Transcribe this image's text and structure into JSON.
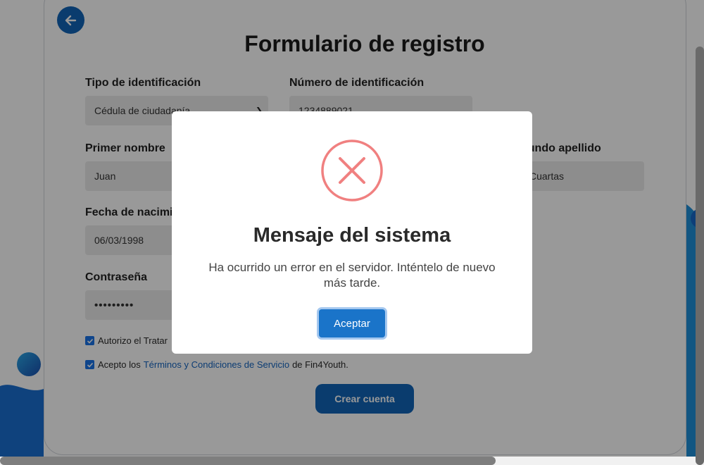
{
  "form": {
    "title": "Formulario de registro",
    "back_icon": "arrow-left-icon",
    "id_type": {
      "label": "Tipo de identificación",
      "value": "Cédula de ciudadanía"
    },
    "id_number": {
      "label": "Número de identificación",
      "value": "1234889021"
    },
    "first_name": {
      "label": "Primer nombre",
      "value": "Juan"
    },
    "second_surname": {
      "label": "Segundo apellido",
      "visible_label": "gundo apellido",
      "visible_value": "Cuartas"
    },
    "birth_date": {
      "label_visible": "Fecha de nacimier",
      "value": "06/03/1998"
    },
    "password": {
      "label": "Contraseña",
      "value": "•••••••••"
    },
    "consent_data": {
      "text_visible": "Autorizo el Tratar",
      "checked": true
    },
    "consent_terms": {
      "prefix": "Acepto los",
      "link": "Términos y Condiciones de Servicio",
      "suffix": "de Fin4Youth.",
      "checked": true
    },
    "submit_label": "Crear cuenta"
  },
  "modal": {
    "icon": "error-x-icon",
    "title": "Mensaje del sistema",
    "message": "Ha ocurrido un error en el servidor. Inténtelo de nuevo más tarde.",
    "accept_label": "Aceptar"
  },
  "colors": {
    "primary": "#1265b7",
    "error": "#f07f7f",
    "overlay": "rgba(0,0,0,0.4)"
  }
}
